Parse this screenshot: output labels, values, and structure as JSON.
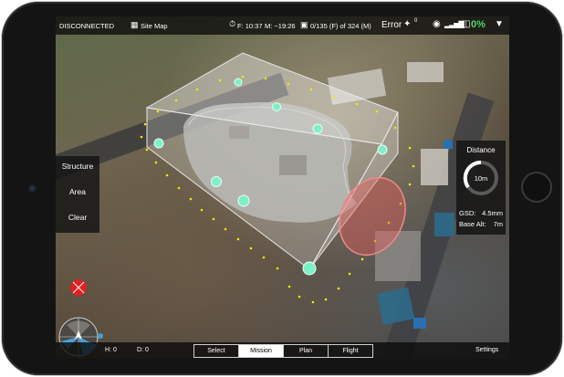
{
  "header": {
    "connection_status": "DISCONNECTED",
    "site_map_label": "Site Map",
    "flight_time": "F: 10:37",
    "mission_time": "M: ~19:26",
    "photo_count": "0/135 (F) of 324 (M)",
    "error_label": "Error",
    "satellite_count": "0",
    "battery_percent": "0%"
  },
  "left_menu": {
    "items": [
      "Structure",
      "Area",
      "Clear"
    ]
  },
  "distance_panel": {
    "title": "Distance",
    "dial_value": "10m",
    "gsd_label": "GSD:",
    "gsd_value": "4.5mm",
    "base_alt_label": "Base Alt:",
    "base_alt_value": "7m"
  },
  "status": {
    "height": "H: 0",
    "distance": "D: 0"
  },
  "tabs": {
    "items": [
      "Select",
      "Mission",
      "Plan",
      "Flight"
    ],
    "active": "Mission"
  },
  "bottom": {
    "settings_label": "Settings"
  },
  "colors": {
    "accent_green": "#4cd964",
    "waypoint": "#7ef0c8",
    "path_dot": "#f2e600",
    "marker_red": "#e02020",
    "no_fly_zone": "#e05050"
  },
  "icons": [
    "stopwatch-icon",
    "photo-icon",
    "site-map-icon",
    "satellite-icon",
    "remote-controller-icon",
    "signal-bars-icon",
    "battery-icon",
    "wifi-icon",
    "compass-icon",
    "drone-marker-icon"
  ]
}
